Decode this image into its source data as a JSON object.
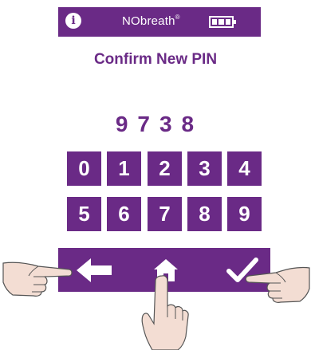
{
  "status_bar": {
    "info_icon": "info-icon",
    "brand": "NObreath",
    "brand_mark": "®",
    "battery_icon": "battery-full-icon"
  },
  "title": "Confirm New PIN",
  "pin_display": "9738",
  "keypad": {
    "row1": [
      "0",
      "1",
      "2",
      "3",
      "4"
    ],
    "row2": [
      "5",
      "6",
      "7",
      "8",
      "9"
    ]
  },
  "nav": {
    "back_icon": "arrow-left-icon",
    "home_icon": "home-icon",
    "confirm_icon": "checkmark-icon"
  },
  "colors": {
    "brand_purple": "#6a2a86",
    "background": "#ffffff",
    "hand_skin": "#f3ddd3"
  }
}
